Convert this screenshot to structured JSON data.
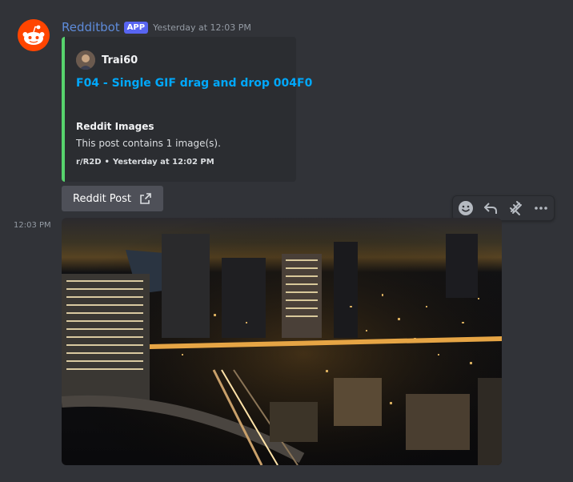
{
  "message": {
    "username": "Redditbot",
    "badge": "APP",
    "timestamp": "Yesterday at 12:03 PM",
    "side_timestamp": "12:03 PM"
  },
  "embed": {
    "accent_color": "#57d36d",
    "author": "Trai60",
    "title": "F04 - Single GIF drag and drop 004F0",
    "field_name": "Reddit Images",
    "field_value": "This post contains 1 image(s).",
    "footer_source": "r/R2D",
    "footer_separator": "•",
    "footer_time": "Yesterday at 12:02 PM"
  },
  "button": {
    "label": "Reddit Post",
    "icon": "external-link-icon"
  },
  "toolbar": {
    "icons": [
      "add-reaction-icon",
      "reply-icon",
      "app-icon",
      "more-icon"
    ]
  },
  "attachment": {
    "type": "image",
    "description_icon": "city-night-image"
  },
  "colors": {
    "background": "#313338",
    "embed_background": "#2b2d31",
    "username": "#5e8bd9",
    "badge": "#5865f2",
    "link": "#00a8fc",
    "button": "#4e5058",
    "reddit_orange": "#ff4500"
  }
}
